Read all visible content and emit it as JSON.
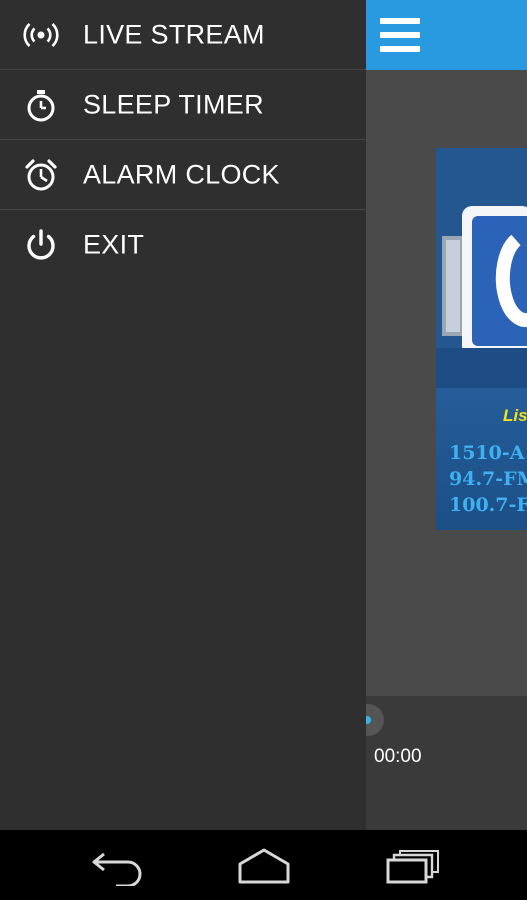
{
  "drawer": {
    "items": [
      {
        "label": "LIVE STREAM",
        "icon": "broadcast-icon"
      },
      {
        "label": "SLEEP TIMER",
        "icon": "stopwatch-icon"
      },
      {
        "label": "ALARM CLOCK",
        "icon": "alarm-clock-icon"
      },
      {
        "label": "EXIT",
        "icon": "power-icon"
      }
    ]
  },
  "app": {
    "toolbar_color": "#2a9ae0",
    "card": {
      "listen_text": "Lis",
      "frequencies": [
        "1510-A",
        "94.7-FM",
        "100.7-F"
      ]
    },
    "player": {
      "time": "00:00"
    }
  },
  "navbar": {
    "buttons": [
      "back-icon",
      "home-icon",
      "recent-apps-icon"
    ]
  }
}
